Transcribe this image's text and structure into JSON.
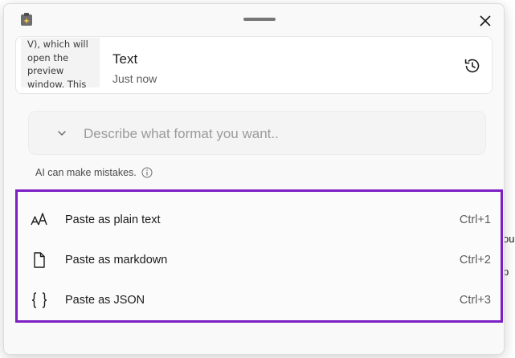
{
  "window": {
    "app_icon": "advanced-paste-icon",
    "close_icon": "close-icon"
  },
  "clipboard": {
    "thumbnail_text": "V), which will open the preview window. This",
    "type": "Text",
    "time": "Just now",
    "history_icon": "history-icon"
  },
  "prompt": {
    "placeholder": "Describe what format you want.."
  },
  "ai_note": "AI can make mistakes.",
  "options": [
    {
      "label": "Paste as plain text",
      "shortcut": "Ctrl+1",
      "icon": "font-size-icon"
    },
    {
      "label": "Paste as markdown",
      "shortcut": "Ctrl+2",
      "icon": "document-icon"
    },
    {
      "label": "Paste as JSON",
      "shortcut": "Ctrl+3",
      "icon": "braces-icon"
    }
  ],
  "background": {
    "fragments": [
      "ou",
      "p"
    ]
  },
  "colors": {
    "highlight_border": "#7c1fc4"
  }
}
